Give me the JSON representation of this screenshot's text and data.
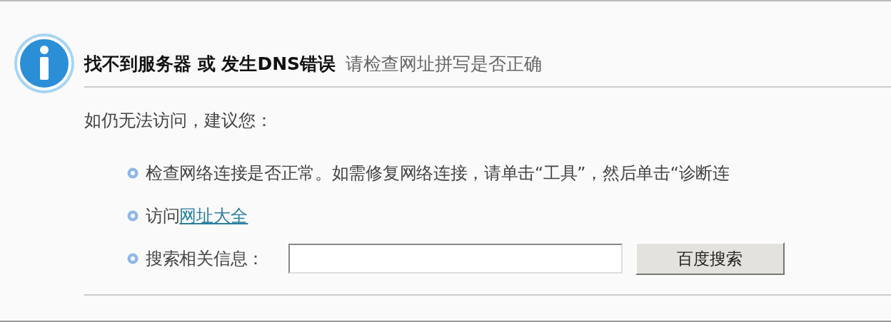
{
  "title": "找不到服务器 或 发生DNS错误",
  "hint": "请检查网址拼写是否正确",
  "intro": "如仍无法访问，建议您：",
  "suggestions": [
    {
      "kind": "text",
      "text": "检查网络连接是否正常。如需修复网络连接，请单击“工具”，然后单击“诊断连"
    },
    {
      "kind": "link",
      "text": "访问",
      "link": "网址大全"
    },
    {
      "kind": "search",
      "text": "搜索相关信息：",
      "button": "百度搜索"
    }
  ]
}
